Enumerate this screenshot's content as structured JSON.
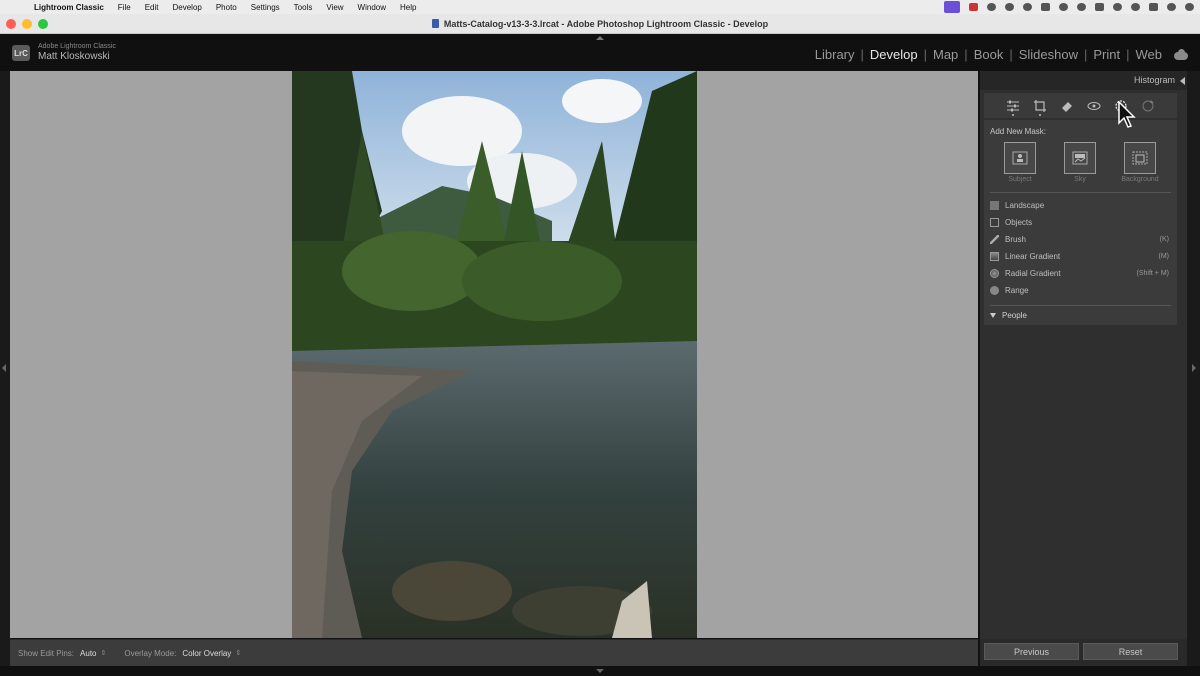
{
  "menubar": {
    "app_name": "Lightroom Classic",
    "items": [
      "File",
      "Edit",
      "Develop",
      "Photo",
      "Settings",
      "Tools",
      "View",
      "Window",
      "Help"
    ]
  },
  "window": {
    "title": "Matts-Catalog-v13-3-3.lrcat - Adobe Photoshop Lightroom Classic - Develop"
  },
  "identity": {
    "product": "Adobe Lightroom Classic",
    "user": "Matt Kloskowski",
    "badge": "LrC"
  },
  "modules": {
    "items": [
      "Library",
      "Develop",
      "Map",
      "Book",
      "Slideshow",
      "Print",
      "Web"
    ],
    "active": "Develop"
  },
  "right_panel": {
    "histogram_label": "Histogram",
    "tools": [
      "edit-sliders",
      "crop",
      "healing",
      "red-eye",
      "masking",
      "preset-reset"
    ],
    "active_tool": "masking",
    "mask": {
      "add_new_label": "Add New Mask:",
      "quick_buttons": [
        {
          "label": "Subject",
          "icon": "subject-icon"
        },
        {
          "label": "Sky",
          "icon": "sky-icon"
        },
        {
          "label": "Background",
          "icon": "background-icon"
        }
      ],
      "items": [
        {
          "label": "Landscape",
          "shortcut": "",
          "icon": "landscape-icon"
        },
        {
          "label": "Objects",
          "shortcut": "",
          "icon": "objects-icon"
        },
        {
          "label": "Brush",
          "shortcut": "(K)",
          "icon": "brush-icon"
        },
        {
          "label": "Linear Gradient",
          "shortcut": "(M)",
          "icon": "linear-gradient-icon"
        },
        {
          "label": "Radial Gradient",
          "shortcut": "(Shift + M)",
          "icon": "radial-gradient-icon"
        },
        {
          "label": "Range",
          "shortcut": "",
          "icon": "range-icon"
        }
      ],
      "people_label": "People"
    }
  },
  "toolbar": {
    "edit_pins_label": "Show Edit Pins:",
    "edit_pins_value": "Auto",
    "overlay_label": "Overlay Mode:",
    "overlay_value": "Color Overlay"
  },
  "bottom_buttons": {
    "previous": "Previous",
    "reset": "Reset"
  },
  "colors": {
    "panel_bg": "#2f2f2f",
    "canvas_bg": "#a3a3a3",
    "active_module": "#e8e8e8"
  }
}
